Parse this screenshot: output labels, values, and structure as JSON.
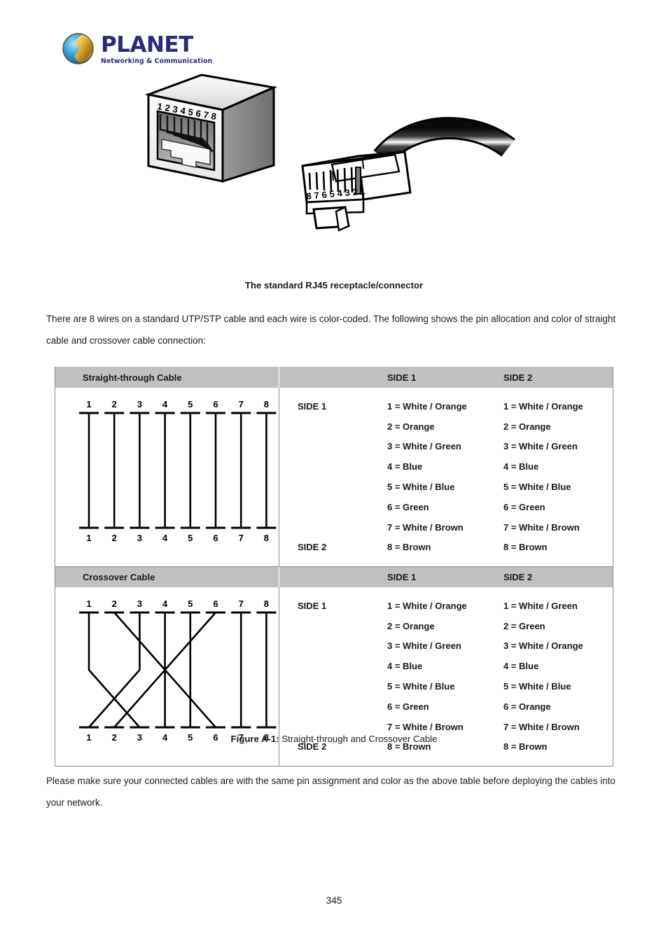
{
  "brand": {
    "name": "PLANET",
    "tagline": "Networking & Communication",
    "color": "#2b2a7a",
    "logo_icon": "globe-logo-icon"
  },
  "figures": {
    "receptacle_caption": "The standard RJ45 receptacle/connector",
    "receptacle_pins": [
      "1",
      "2",
      "3",
      "4",
      "5",
      "6",
      "7",
      "8"
    ],
    "plug_pins": [
      "8",
      "7",
      "6",
      "5",
      "4",
      "3",
      "2",
      "1"
    ],
    "figure_caption_label": "Figure A-1:",
    "figure_caption_text": " Straight-through and Crossover Cable"
  },
  "paragraphs": {
    "intro": "There are 8 wires on a standard UTP/STP cable and each wire is color-coded. The following shows the pin allocation and color of straight cable and crossover cable connection:",
    "note": "Please make sure your connected cables are with the same pin assignment and color as the above table before deploying the cables into your network."
  },
  "table": {
    "header_side1": "SIDE 1",
    "header_side2": "SIDE 2",
    "side1_label": "SIDE 1",
    "side2_label": "SIDE 2",
    "sections": [
      {
        "title": "Straight-through Cable",
        "pins_top": [
          "1",
          "2",
          "3",
          "4",
          "5",
          "6",
          "7",
          "8"
        ],
        "pins_bottom": [
          "1",
          "2",
          "3",
          "4",
          "5",
          "6",
          "7",
          "8"
        ],
        "mapping": [
          1,
          2,
          3,
          4,
          5,
          6,
          7,
          8
        ],
        "side1": [
          "1 = White / Orange",
          "2 = Orange",
          "3 = White / Green",
          "4 = Blue",
          "5 = White / Blue",
          "6 = Green",
          "7 = White / Brown",
          "8 = Brown"
        ],
        "side2": [
          "1 = White / Orange",
          "2 = Orange",
          "3 = White / Green",
          "4 = Blue",
          "5 = White / Blue",
          "6 = Green",
          "7 = White / Brown",
          "8 = Brown"
        ]
      },
      {
        "title": "Crossover Cable",
        "pins_top": [
          "1",
          "2",
          "3",
          "4",
          "5",
          "6",
          "7",
          "8"
        ],
        "pins_bottom": [
          "1",
          "2",
          "3",
          "4",
          "5",
          "6",
          "7",
          "8"
        ],
        "mapping": [
          3,
          6,
          1,
          4,
          5,
          2,
          7,
          8
        ],
        "side1": [
          "1 = White / Orange",
          "2 = Orange",
          "3 = White / Green",
          "4 = Blue",
          "5 = White / Blue",
          "6 = Green",
          "7 = White / Brown",
          "8 = Brown"
        ],
        "side2": [
          "1 = White / Green",
          "2 = Green",
          "3 = White / Orange",
          "4 = Blue",
          "5 = White / Blue",
          "6 = Orange",
          "7 = White / Brown",
          "8 = Brown"
        ]
      }
    ]
  },
  "footer": {
    "page_number": "345"
  }
}
